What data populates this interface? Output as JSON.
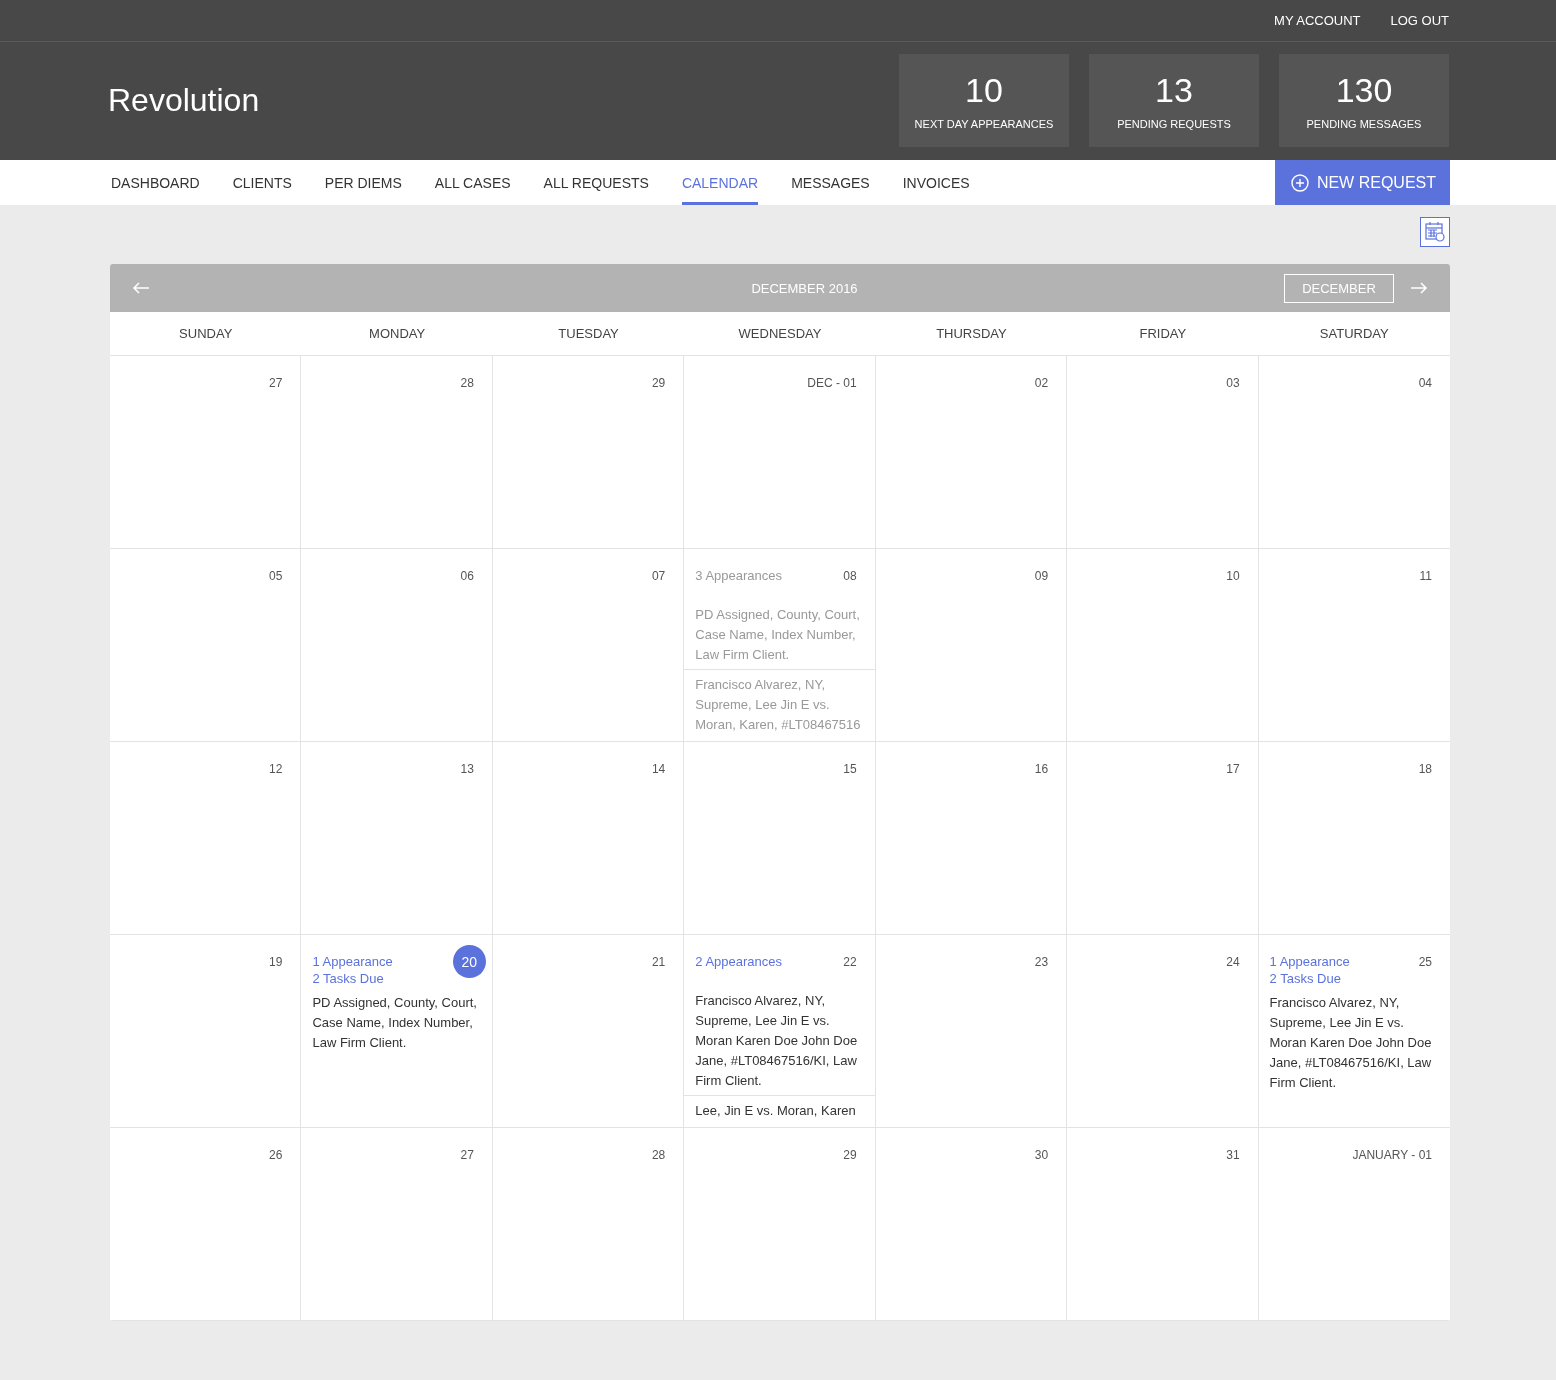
{
  "top_links": [
    "MY ACCOUNT",
    "LOG OUT"
  ],
  "brand": "Revolution",
  "stats": [
    {
      "value": "10",
      "label": "NEXT DAY APPEARANCES"
    },
    {
      "value": "13",
      "label": "PENDING REQUESTS"
    },
    {
      "value": "130",
      "label": "PENDING MESSAGES"
    }
  ],
  "nav": [
    {
      "label": "DASHBOARD",
      "selected": false
    },
    {
      "label": "CLIENTS",
      "selected": false
    },
    {
      "label": "PER DIEMS",
      "selected": false
    },
    {
      "label": "ALL CASES",
      "selected": false
    },
    {
      "label": "ALL REQUESTS",
      "selected": false
    },
    {
      "label": "CALENDAR",
      "selected": true
    },
    {
      "label": "MESSAGES",
      "selected": false
    },
    {
      "label": "INVOICES",
      "selected": false
    }
  ],
  "new_request": "NEW REQUEST",
  "calendar": {
    "title": "DECEMBER 2016",
    "view_button": "DECEMBER",
    "weekdays": [
      "SUNDAY",
      "MONDAY",
      "TUESDAY",
      "WEDNESDAY",
      "THURSDAY",
      "FRIDAY",
      "SATURDAY"
    ],
    "weeks": [
      [
        {
          "date": "27"
        },
        {
          "date": "28"
        },
        {
          "date": "29"
        },
        {
          "date": "DEC - 01"
        },
        {
          "date": "02"
        },
        {
          "date": "03"
        },
        {
          "date": "04"
        }
      ],
      [
        {
          "date": "05"
        },
        {
          "date": "06"
        },
        {
          "date": "07"
        },
        {
          "date": "08",
          "muted": true,
          "summary": [
            "3 Appearances"
          ],
          "entries": [
            "PD Assigned, County, Court, Case Name, Index Number, Law Firm Client.",
            "Francisco Alvarez, NY, Supreme, Lee Jin E vs. Moran, Karen, #LT08467516"
          ]
        },
        {
          "date": "09"
        },
        {
          "date": "10"
        },
        {
          "date": "11"
        }
      ],
      [
        {
          "date": "12"
        },
        {
          "date": "13"
        },
        {
          "date": "14"
        },
        {
          "date": "15"
        },
        {
          "date": "16"
        },
        {
          "date": "17"
        },
        {
          "date": "18"
        }
      ],
      [
        {
          "date": "19"
        },
        {
          "date": "20",
          "today": true,
          "summary": [
            "1 Appearance",
            "2 Tasks Due"
          ],
          "entries": [
            "PD Assigned, County, Court, Case Name, Index Number, Law Firm Client."
          ]
        },
        {
          "date": "21"
        },
        {
          "date": "22",
          "summary": [
            "2 Appearances"
          ],
          "entries": [
            "Francisco Alvarez, NY, Supreme, Lee Jin E vs. Moran Karen Doe John Doe Jane, #LT08467516/KI, Law Firm Client.",
            "Lee, Jin E vs. Moran, Karen"
          ]
        },
        {
          "date": "23"
        },
        {
          "date": "24"
        },
        {
          "date": "25",
          "summary": [
            "1 Appearance",
            "2 Tasks Due"
          ],
          "entries": [
            "Francisco Alvarez, NY, Supreme, Lee Jin E vs. Moran Karen Doe John Doe Jane, #LT08467516/KI, Law Firm Client."
          ]
        }
      ],
      [
        {
          "date": "26"
        },
        {
          "date": "27"
        },
        {
          "date": "28"
        },
        {
          "date": "29"
        },
        {
          "date": "30"
        },
        {
          "date": "31"
        },
        {
          "date": "JANUARY - 01"
        }
      ]
    ]
  }
}
